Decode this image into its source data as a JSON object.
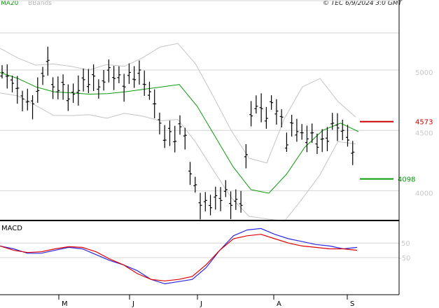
{
  "header": {
    "legend_ma": "MA20",
    "legend_bb": "BBands",
    "stamp": "© TEC 6/9/2024 3:0 GMT"
  },
  "colors": {
    "candles": "#000000",
    "ma20": "#0a9a0a",
    "bbands": "#c4c4c4",
    "resistance": "#cc0000",
    "support": "#0a9a0a",
    "macd": "#2a2ae0",
    "signal": "#e00000",
    "grid": "#d4d4d4",
    "frame": "#000000"
  },
  "chart_data": [
    {
      "type": "line",
      "title": "",
      "x": [
        "M",
        "J",
        "J",
        "A",
        "S"
      ],
      "yticks": [
        4000,
        4500,
        5000
      ],
      "ylim": [
        3760,
        5510
      ],
      "grid": true,
      "series": [
        {
          "name": "MA20",
          "values": [
            4980,
            4930,
            4860,
            4820,
            4810,
            4800,
            4805,
            4820,
            4840,
            4860,
            4880,
            4700,
            4450,
            4200,
            4010,
            3980,
            4140,
            4360,
            4500,
            4560,
            4490
          ]
        },
        {
          "name": "BBands",
          "values": [
            5180,
            5000,
            5200,
            5150,
            5100,
            5000,
            4700,
            4500,
            4250,
            4150,
            4000,
            4100,
            5300,
            5100,
            4500,
            4560,
            4520,
            4550
          ]
        }
      ],
      "ohlc_sample": [
        {
          "h": 5190,
          "l": 4680
        },
        {
          "h": 5210,
          "l": 4760
        },
        {
          "h": 5090,
          "l": 4860
        },
        {
          "h": 5320,
          "l": 4800
        },
        {
          "h": 5060,
          "l": 4620
        },
        {
          "h": 4660,
          "l": 4420
        },
        {
          "h": 4510,
          "l": 4260
        },
        {
          "h": 4110,
          "l": 3830
        },
        {
          "h": 4060,
          "l": 3820
        },
        {
          "h": 4800,
          "l": 4320
        },
        {
          "h": 4650,
          "l": 4280
        },
        {
          "h": 4560,
          "l": 4430
        },
        {
          "h": 4400,
          "l": 4300
        }
      ],
      "annotations": [
        {
          "label": "4573",
          "value": 4573,
          "role": "resistance"
        },
        {
          "label": "4098",
          "value": 4098,
          "role": "support"
        }
      ]
    },
    {
      "type": "line",
      "title": "MACD",
      "x": [
        "M",
        "J",
        "J",
        "A",
        "S"
      ],
      "yticks": [
        50,
        -50
      ],
      "ytick_labels": [
        "50",
        "-50"
      ],
      "ylim": [
        -300,
        200
      ],
      "series": [
        {
          "name": "MACD",
          "values": [
            30,
            10,
            -20,
            -20,
            0,
            20,
            10,
            -30,
            -70,
            -100,
            -140,
            -200,
            -230,
            -215,
            -200,
            -120,
            0,
            100,
            140,
            150,
            110,
            80,
            60,
            40,
            30,
            10,
            20
          ]
        },
        {
          "name": "Signal",
          "values": [
            30,
            0,
            -15,
            -10,
            10,
            25,
            20,
            -10,
            -60,
            -100,
            -160,
            -200,
            -210,
            -200,
            -180,
            -100,
            0,
            80,
            100,
            110,
            80,
            50,
            30,
            20,
            10,
            10,
            0
          ]
        }
      ]
    }
  ]
}
